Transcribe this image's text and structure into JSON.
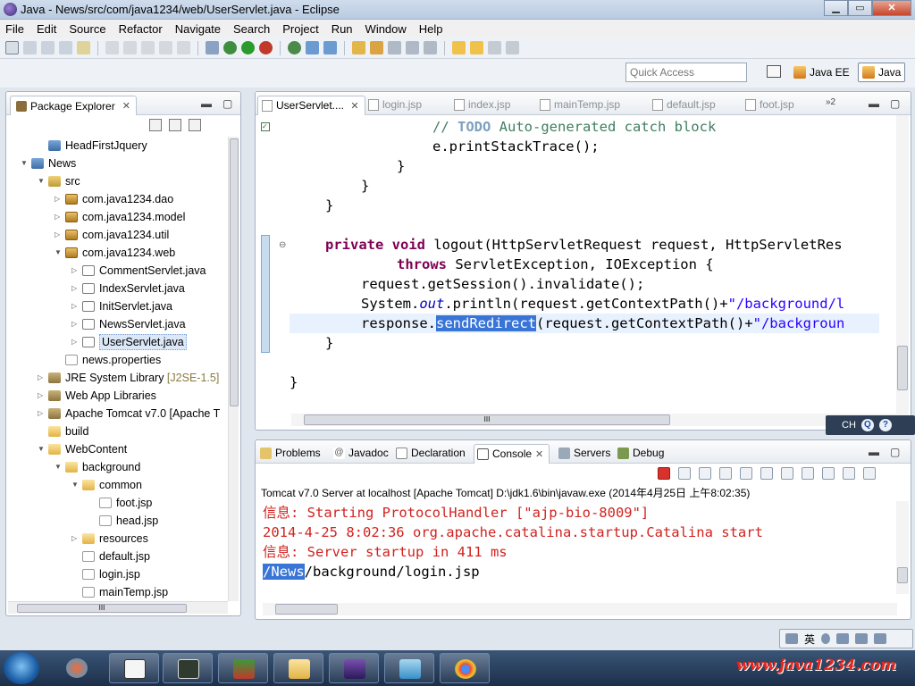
{
  "window": {
    "title": "Java - News/src/com/java1234/web/UserServlet.java - Eclipse",
    "min": "▁",
    "max": "▭",
    "close": "✕"
  },
  "menu": [
    "File",
    "Edit",
    "Source",
    "Refactor",
    "Navigate",
    "Search",
    "Project",
    "Run",
    "Window",
    "Help"
  ],
  "quick_access": {
    "placeholder": "Quick Access"
  },
  "perspectives": {
    "javaee": "Java EE",
    "java": "Java"
  },
  "package_explorer": {
    "title": "Package Explorer",
    "tree": [
      {
        "label": "HeadFirstJquery",
        "depth": 1,
        "icon": "project-icon",
        "arrow": ""
      },
      {
        "label": "News",
        "depth": 0,
        "icon": "project-icon",
        "arrow": "▼"
      },
      {
        "label": "src",
        "depth": 1,
        "icon": "source-folder-icon",
        "arrow": "▼"
      },
      {
        "label": "com.java1234.dao",
        "depth": 2,
        "icon": "package-icon",
        "arrow": "▷"
      },
      {
        "label": "com.java1234.model",
        "depth": 2,
        "icon": "package-icon",
        "arrow": "▷"
      },
      {
        "label": "com.java1234.util",
        "depth": 2,
        "icon": "package-icon",
        "arrow": "▷"
      },
      {
        "label": "com.java1234.web",
        "depth": 2,
        "icon": "package-icon",
        "arrow": "▼"
      },
      {
        "label": "CommentServlet.java",
        "depth": 3,
        "icon": "java-file-icon",
        "arrow": "▷"
      },
      {
        "label": "IndexServlet.java",
        "depth": 3,
        "icon": "java-file-icon",
        "arrow": "▷"
      },
      {
        "label": "InitServlet.java",
        "depth": 3,
        "icon": "java-file-icon",
        "arrow": "▷"
      },
      {
        "label": "NewsServlet.java",
        "depth": 3,
        "icon": "java-file-icon",
        "arrow": "▷"
      },
      {
        "label": "UserServlet.java",
        "depth": 3,
        "icon": "java-file-icon",
        "arrow": "▷",
        "selected": true
      },
      {
        "label": "news.properties",
        "depth": 2,
        "icon": "file-icon",
        "arrow": ""
      },
      {
        "label": "JRE System Library",
        "suffix": " [J2SE-1.5]",
        "depth": 1,
        "icon": "library-icon",
        "arrow": "▷"
      },
      {
        "label": "Web App Libraries",
        "depth": 1,
        "icon": "library-icon",
        "arrow": "▷"
      },
      {
        "label": "Apache Tomcat v7.0 [Apache T",
        "depth": 1,
        "icon": "library-icon",
        "arrow": "▷"
      },
      {
        "label": "build",
        "depth": 1,
        "icon": "folder-icon",
        "arrow": ""
      },
      {
        "label": "WebContent",
        "depth": 1,
        "icon": "folder-icon",
        "arrow": "▼"
      },
      {
        "label": "background",
        "depth": 2,
        "icon": "folder-icon",
        "arrow": "▼"
      },
      {
        "label": "common",
        "depth": 3,
        "icon": "folder-icon",
        "arrow": "▼"
      },
      {
        "label": "foot.jsp",
        "depth": 4,
        "icon": "file-icon",
        "arrow": ""
      },
      {
        "label": "head.jsp",
        "depth": 4,
        "icon": "file-icon",
        "arrow": ""
      },
      {
        "label": "resources",
        "depth": 3,
        "icon": "folder-icon",
        "arrow": "▷"
      },
      {
        "label": "default.jsp",
        "depth": 3,
        "icon": "file-icon",
        "arrow": ""
      },
      {
        "label": "login.jsp",
        "depth": 3,
        "icon": "file-icon",
        "arrow": ""
      },
      {
        "label": "mainTemp.jsp",
        "depth": 3,
        "icon": "file-icon",
        "arrow": ""
      }
    ]
  },
  "editor": {
    "tabs": [
      "UserServlet....",
      "login.jsp",
      "index.jsp",
      "mainTemp.jsp",
      "default.jsp",
      "foot.jsp"
    ],
    "overflow": "»2",
    "code": {
      "l1_comment": "// ",
      "l1_todo": "TODO",
      "l1_rest": " Auto-generated catch block",
      "l2": "e.printStackTrace();",
      "l3": "}",
      "l4": "}",
      "l5": "}",
      "l6_kw1": "private",
      "l6_kw2": "void",
      "l6_rest": " logout(HttpServletRequest request, HttpServletRes",
      "l7_kw": "throws",
      "l7_rest": " ServletException, IOException {",
      "l8": "request.getSession().invalidate();",
      "l9_a": "System.",
      "l9_out": "out",
      "l9_b": ".println(request.getContextPath()+",
      "l9_str": "\"/background/l",
      "l10_a": "response.",
      "l10_hl": "sendRedirect",
      "l10_b": "(request.getContextPath()+",
      "l10_str": "\"/backgroun",
      "l11": "}",
      "l12": "}"
    }
  },
  "ime": {
    "label": "CH"
  },
  "console_view": {
    "tabs": [
      "Problems",
      "Javadoc",
      "Declaration",
      "Console",
      "Servers",
      "Debug"
    ],
    "description": "Tomcat v7.0 Server at localhost [Apache Tomcat] D:\\jdk1.6\\bin\\javaw.exe (2014年4月25日 上午8:02:35)",
    "lines": [
      "信息: Starting ProtocolHandler [\"ajp-bio-8009\"]",
      "2014-4-25 8:02:36 org.apache.catalina.startup.Catalina start",
      "信息: Server startup in 411 ms"
    ],
    "last_hl": "/News",
    "last_rest": "/background/login.jsp"
  },
  "langbar": {
    "label": "英"
  },
  "watermark": "www.java1234.com",
  "colors": {
    "keyword": "#7f0055",
    "comment": "#3f7f5f",
    "string": "#2a00ff",
    "console_err": "#d1231f",
    "selection": "#3875d7"
  }
}
